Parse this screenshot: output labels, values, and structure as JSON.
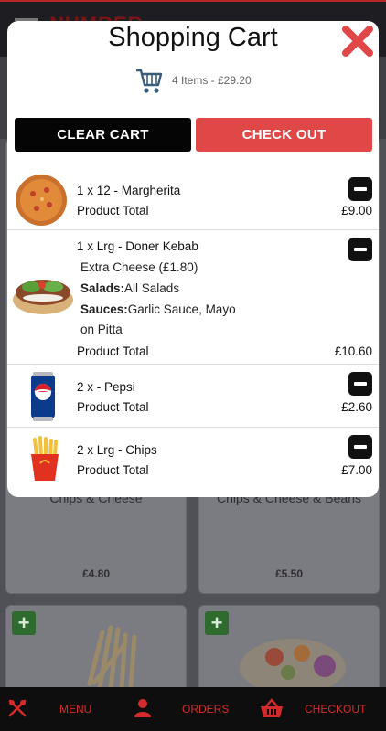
{
  "background": {
    "brand": "NUMBER",
    "cards": [
      {
        "name": "Chips & Cheese",
        "price": "£4.80"
      },
      {
        "name": "Chips & Cheese & Beans",
        "price": "£5.50"
      }
    ]
  },
  "modal": {
    "title": "Shopping Cart",
    "summary": "4 Items - £29.20",
    "clear_label": "CLEAR CART",
    "checkout_label": "CHECK OUT",
    "items": [
      {
        "name": "1 x 12 - Margherita",
        "options": [],
        "total_label": "Product Total",
        "total": "£9.00",
        "image": "pizza"
      },
      {
        "name": "1 x Lrg - Doner Kebab",
        "options": [
          {
            "key": "",
            "value": "Extra Cheese (£1.80)"
          },
          {
            "key": "Salads:",
            "value": "All Salads"
          },
          {
            "key": "Sauces:",
            "value": "Garlic Sauce, Mayo"
          },
          {
            "key": "",
            "value": "on Pitta"
          }
        ],
        "total_label": "Product Total",
        "total": "£10.60",
        "image": "kebab"
      },
      {
        "name": "2 x - Pepsi",
        "options": [],
        "total_label": "Product Total",
        "total": "£2.60",
        "image": "can"
      },
      {
        "name": "2 x Lrg - Chips",
        "options": [],
        "total_label": "Product Total",
        "total": "£7.00",
        "image": "fries"
      }
    ]
  },
  "nav": {
    "menu_label": "MENU",
    "orders_label": "ORDERS",
    "checkout_label": "CHECKOUT"
  },
  "colors": {
    "accent": "#e04848",
    "nav_accent": "#d32b2b",
    "dark": "#050505"
  },
  "icons": {
    "close": "close-icon",
    "cart": "cart-icon",
    "minus": "minus-icon",
    "menu": "fork-knife-icon",
    "orders": "user-icon",
    "checkout": "basket-icon"
  }
}
